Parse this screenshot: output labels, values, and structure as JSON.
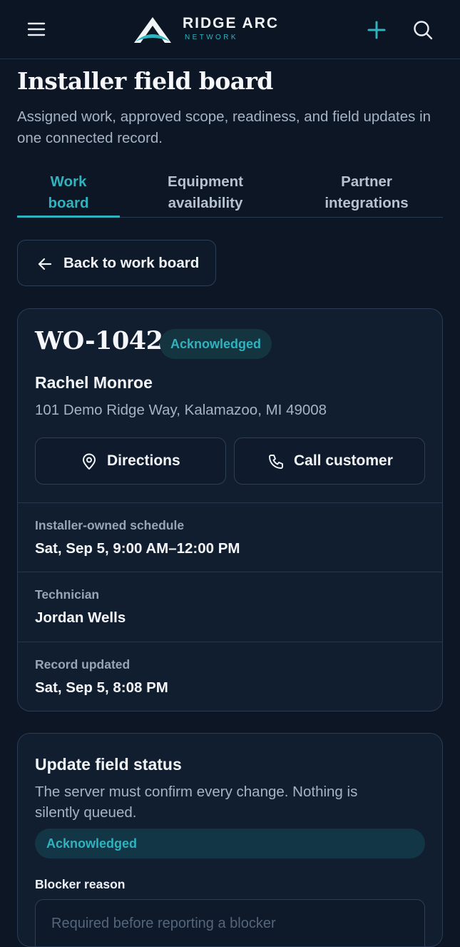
{
  "header": {
    "brand_name": "RIDGE ARC",
    "brand_sub": "NETWORK",
    "menu_icon": "hamburger-menu-icon",
    "add_icon": "plus-icon",
    "search_icon": "search-icon",
    "accent_color": "#2fb3be"
  },
  "page": {
    "title": "Installer field board",
    "subtitle": "Assigned work, approved scope, readiness, and field updates in one connected record."
  },
  "tabs": [
    {
      "label": "Work board",
      "active": true
    },
    {
      "label": "Equipment availability",
      "active": false
    },
    {
      "label": "Partner integrations",
      "active": false
    }
  ],
  "back_button": {
    "label": "Back to work board",
    "icon": "arrow-left-icon"
  },
  "work_order": {
    "id": "WO-1042",
    "status": "Acknowledged",
    "customer_name": "Rachel Monroe",
    "address": "101 Demo Ridge Way, Kalamazoo, MI 49008",
    "actions": [
      {
        "label": "Directions",
        "icon": "map-pin-icon"
      },
      {
        "label": "Call customer",
        "icon": "phone-icon"
      }
    ],
    "details": [
      {
        "label": "Installer-owned schedule",
        "value": "Sat, Sep 5, 9:00 AM–12:00 PM"
      },
      {
        "label": "Technician",
        "value": "Jordan Wells"
      },
      {
        "label": "Record updated",
        "value": "Sat, Sep 5, 8:08 PM"
      }
    ]
  },
  "status_update": {
    "title": "Update field status",
    "subtitle": "The server must confirm every change. Nothing is silently queued.",
    "selected_status": "Acknowledged",
    "blocker_label": "Blocker reason",
    "blocker_placeholder": "Required before reporting a blocker"
  }
}
